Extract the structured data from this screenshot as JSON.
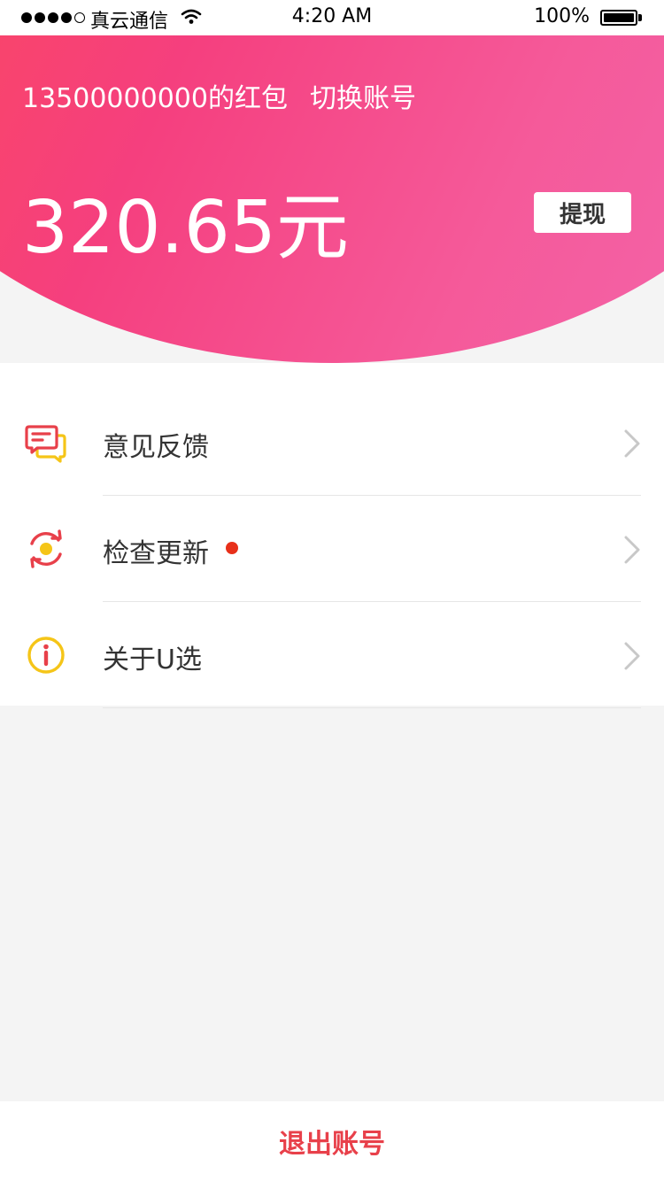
{
  "status_bar": {
    "carrier": "真云通信",
    "time": "4:20 AM",
    "battery_percent": "100%",
    "signal_bars": 4
  },
  "header": {
    "account_title": "13500000000的红包",
    "switch_account": "切换账号",
    "balance": "320.65元",
    "withdraw_label": "提现",
    "gradient_colors": [
      "#ff4d4f",
      "#f53f7e",
      "#f267ae"
    ]
  },
  "menu": {
    "items": [
      {
        "label": "意见反馈",
        "icon": "feedback-icon",
        "icon_colors": [
          "#e8404a",
          "#f5c518"
        ],
        "has_badge": false
      },
      {
        "label": "检查更新",
        "icon": "refresh-update-icon",
        "icon_colors": [
          "#e8404a",
          "#f5c518"
        ],
        "has_badge": true,
        "badge_color": "#e8301a"
      },
      {
        "label": "关于U选",
        "icon": "info-icon",
        "icon_colors": [
          "#f5c518",
          "#e8404a"
        ],
        "has_badge": false
      }
    ]
  },
  "footer": {
    "logout_label": "退出账号",
    "logout_color": "#e8404a"
  }
}
